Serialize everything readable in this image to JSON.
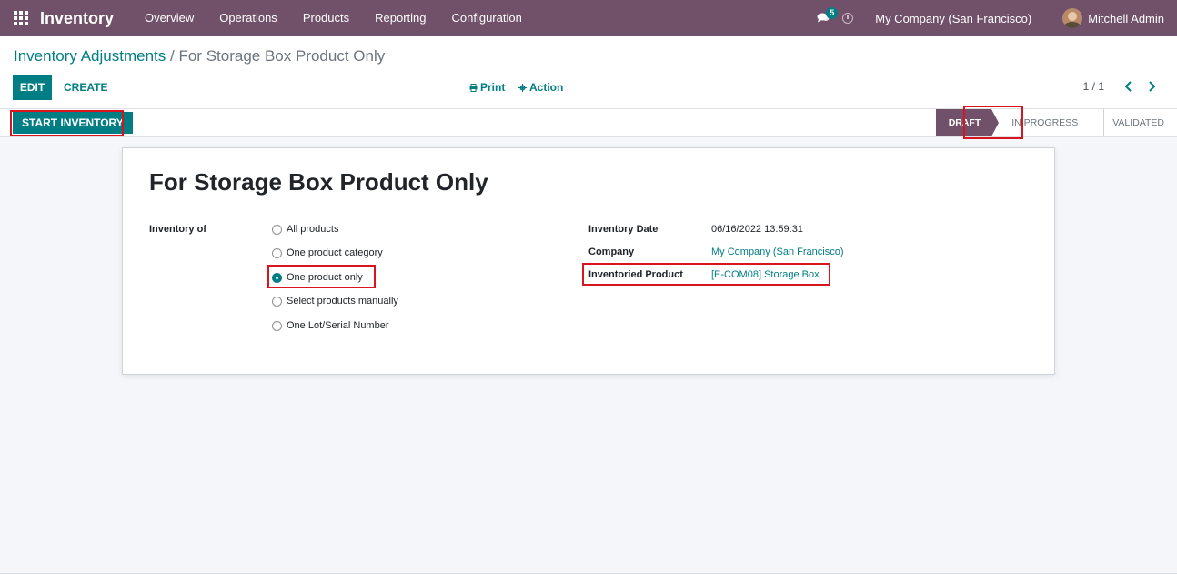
{
  "navbar": {
    "app_title": "Inventory",
    "menu": [
      "Overview",
      "Operations",
      "Products",
      "Reporting",
      "Configuration"
    ],
    "chat_count": "5",
    "company": "My Company (San Francisco)",
    "user": "Mitchell Admin",
    "brand_color": "#71506a"
  },
  "breadcrumb": {
    "parent": "Inventory Adjustments",
    "separator": "/",
    "current": "For Storage Box Product Only"
  },
  "toolbar": {
    "edit_label": "EDIT",
    "create_label": "CREATE",
    "print_label": "Print",
    "action_label": "Action",
    "pager": "1 / 1",
    "accent_color": "#017e84"
  },
  "statusbar": {
    "start_label": "START INVENTORY",
    "steps": [
      "DRAFT",
      "IN PROGRESS",
      "VALIDATED"
    ],
    "active_step": "DRAFT"
  },
  "form": {
    "title": "For Storage Box Product Only",
    "inventory_of_label": "Inventory of",
    "options": [
      "All products",
      "One product category",
      "One product only",
      "Select products manually",
      "One Lot/Serial Number"
    ],
    "selected_option": "One product only",
    "inventory_date_label": "Inventory Date",
    "inventory_date": "06/16/2022 13:59:31",
    "company_label": "Company",
    "company": "My Company (San Francisco)",
    "product_label": "Inventoried Product",
    "product": "[E-COM08] Storage Box"
  }
}
